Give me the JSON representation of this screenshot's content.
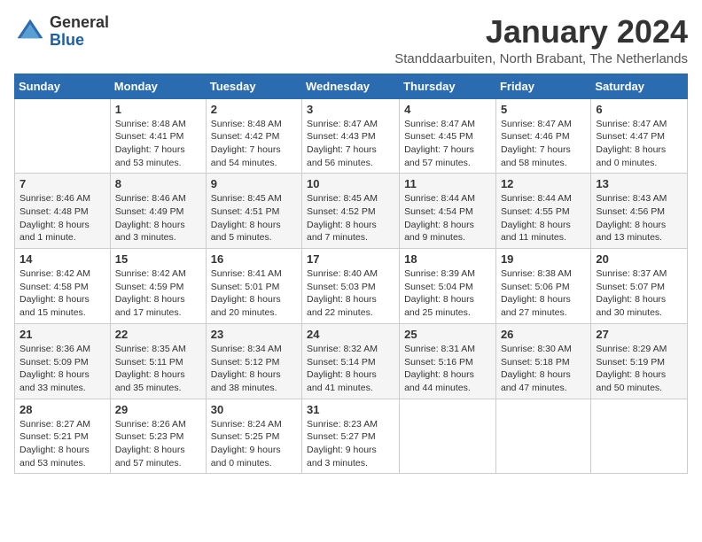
{
  "header": {
    "logo_general": "General",
    "logo_blue": "Blue",
    "month_title": "January 2024",
    "subtitle": "Standdaarbuiten, North Brabant, The Netherlands"
  },
  "weekdays": [
    "Sunday",
    "Monday",
    "Tuesday",
    "Wednesday",
    "Thursday",
    "Friday",
    "Saturday"
  ],
  "weeks": [
    [
      {
        "day": "",
        "sunrise": "",
        "sunset": "",
        "daylight": ""
      },
      {
        "day": "1",
        "sunrise": "Sunrise: 8:48 AM",
        "sunset": "Sunset: 4:41 PM",
        "daylight": "Daylight: 7 hours and 53 minutes."
      },
      {
        "day": "2",
        "sunrise": "Sunrise: 8:48 AM",
        "sunset": "Sunset: 4:42 PM",
        "daylight": "Daylight: 7 hours and 54 minutes."
      },
      {
        "day": "3",
        "sunrise": "Sunrise: 8:47 AM",
        "sunset": "Sunset: 4:43 PM",
        "daylight": "Daylight: 7 hours and 56 minutes."
      },
      {
        "day": "4",
        "sunrise": "Sunrise: 8:47 AM",
        "sunset": "Sunset: 4:45 PM",
        "daylight": "Daylight: 7 hours and 57 minutes."
      },
      {
        "day": "5",
        "sunrise": "Sunrise: 8:47 AM",
        "sunset": "Sunset: 4:46 PM",
        "daylight": "Daylight: 7 hours and 58 minutes."
      },
      {
        "day": "6",
        "sunrise": "Sunrise: 8:47 AM",
        "sunset": "Sunset: 4:47 PM",
        "daylight": "Daylight: 8 hours and 0 minutes."
      }
    ],
    [
      {
        "day": "7",
        "sunrise": "Sunrise: 8:46 AM",
        "sunset": "Sunset: 4:48 PM",
        "daylight": "Daylight: 8 hours and 1 minute."
      },
      {
        "day": "8",
        "sunrise": "Sunrise: 8:46 AM",
        "sunset": "Sunset: 4:49 PM",
        "daylight": "Daylight: 8 hours and 3 minutes."
      },
      {
        "day": "9",
        "sunrise": "Sunrise: 8:45 AM",
        "sunset": "Sunset: 4:51 PM",
        "daylight": "Daylight: 8 hours and 5 minutes."
      },
      {
        "day": "10",
        "sunrise": "Sunrise: 8:45 AM",
        "sunset": "Sunset: 4:52 PM",
        "daylight": "Daylight: 8 hours and 7 minutes."
      },
      {
        "day": "11",
        "sunrise": "Sunrise: 8:44 AM",
        "sunset": "Sunset: 4:54 PM",
        "daylight": "Daylight: 8 hours and 9 minutes."
      },
      {
        "day": "12",
        "sunrise": "Sunrise: 8:44 AM",
        "sunset": "Sunset: 4:55 PM",
        "daylight": "Daylight: 8 hours and 11 minutes."
      },
      {
        "day": "13",
        "sunrise": "Sunrise: 8:43 AM",
        "sunset": "Sunset: 4:56 PM",
        "daylight": "Daylight: 8 hours and 13 minutes."
      }
    ],
    [
      {
        "day": "14",
        "sunrise": "Sunrise: 8:42 AM",
        "sunset": "Sunset: 4:58 PM",
        "daylight": "Daylight: 8 hours and 15 minutes."
      },
      {
        "day": "15",
        "sunrise": "Sunrise: 8:42 AM",
        "sunset": "Sunset: 4:59 PM",
        "daylight": "Daylight: 8 hours and 17 minutes."
      },
      {
        "day": "16",
        "sunrise": "Sunrise: 8:41 AM",
        "sunset": "Sunset: 5:01 PM",
        "daylight": "Daylight: 8 hours and 20 minutes."
      },
      {
        "day": "17",
        "sunrise": "Sunrise: 8:40 AM",
        "sunset": "Sunset: 5:03 PM",
        "daylight": "Daylight: 8 hours and 22 minutes."
      },
      {
        "day": "18",
        "sunrise": "Sunrise: 8:39 AM",
        "sunset": "Sunset: 5:04 PM",
        "daylight": "Daylight: 8 hours and 25 minutes."
      },
      {
        "day": "19",
        "sunrise": "Sunrise: 8:38 AM",
        "sunset": "Sunset: 5:06 PM",
        "daylight": "Daylight: 8 hours and 27 minutes."
      },
      {
        "day": "20",
        "sunrise": "Sunrise: 8:37 AM",
        "sunset": "Sunset: 5:07 PM",
        "daylight": "Daylight: 8 hours and 30 minutes."
      }
    ],
    [
      {
        "day": "21",
        "sunrise": "Sunrise: 8:36 AM",
        "sunset": "Sunset: 5:09 PM",
        "daylight": "Daylight: 8 hours and 33 minutes."
      },
      {
        "day": "22",
        "sunrise": "Sunrise: 8:35 AM",
        "sunset": "Sunset: 5:11 PM",
        "daylight": "Daylight: 8 hours and 35 minutes."
      },
      {
        "day": "23",
        "sunrise": "Sunrise: 8:34 AM",
        "sunset": "Sunset: 5:12 PM",
        "daylight": "Daylight: 8 hours and 38 minutes."
      },
      {
        "day": "24",
        "sunrise": "Sunrise: 8:32 AM",
        "sunset": "Sunset: 5:14 PM",
        "daylight": "Daylight: 8 hours and 41 minutes."
      },
      {
        "day": "25",
        "sunrise": "Sunrise: 8:31 AM",
        "sunset": "Sunset: 5:16 PM",
        "daylight": "Daylight: 8 hours and 44 minutes."
      },
      {
        "day": "26",
        "sunrise": "Sunrise: 8:30 AM",
        "sunset": "Sunset: 5:18 PM",
        "daylight": "Daylight: 8 hours and 47 minutes."
      },
      {
        "day": "27",
        "sunrise": "Sunrise: 8:29 AM",
        "sunset": "Sunset: 5:19 PM",
        "daylight": "Daylight: 8 hours and 50 minutes."
      }
    ],
    [
      {
        "day": "28",
        "sunrise": "Sunrise: 8:27 AM",
        "sunset": "Sunset: 5:21 PM",
        "daylight": "Daylight: 8 hours and 53 minutes."
      },
      {
        "day": "29",
        "sunrise": "Sunrise: 8:26 AM",
        "sunset": "Sunset: 5:23 PM",
        "daylight": "Daylight: 8 hours and 57 minutes."
      },
      {
        "day": "30",
        "sunrise": "Sunrise: 8:24 AM",
        "sunset": "Sunset: 5:25 PM",
        "daylight": "Daylight: 9 hours and 0 minutes."
      },
      {
        "day": "31",
        "sunrise": "Sunrise: 8:23 AM",
        "sunset": "Sunset: 5:27 PM",
        "daylight": "Daylight: 9 hours and 3 minutes."
      },
      {
        "day": "",
        "sunrise": "",
        "sunset": "",
        "daylight": ""
      },
      {
        "day": "",
        "sunrise": "",
        "sunset": "",
        "daylight": ""
      },
      {
        "day": "",
        "sunrise": "",
        "sunset": "",
        "daylight": ""
      }
    ]
  ]
}
